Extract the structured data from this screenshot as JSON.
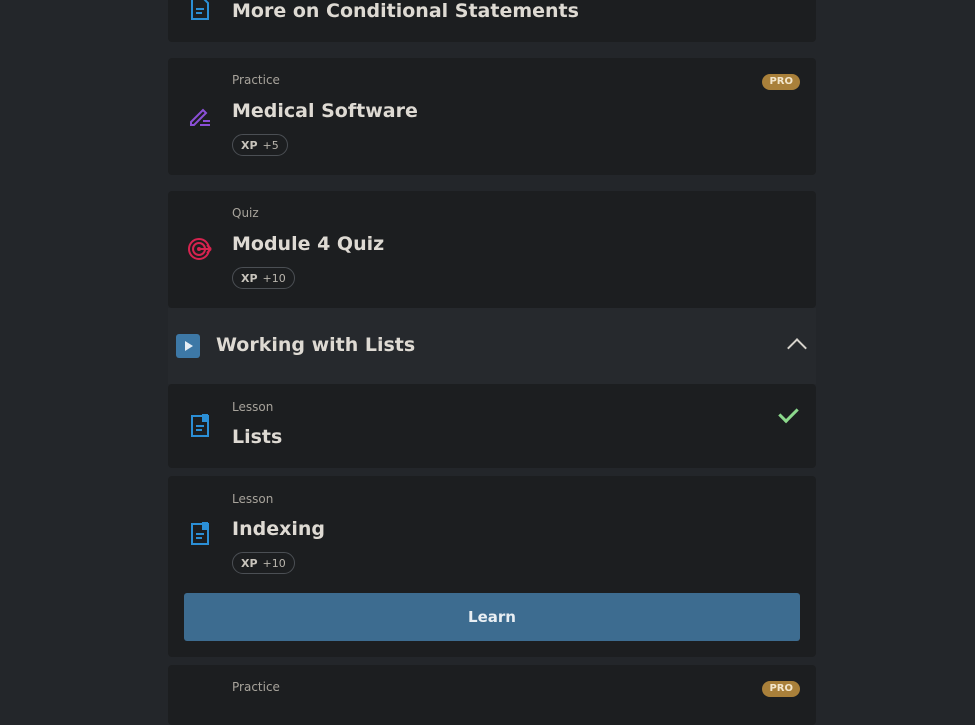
{
  "items": [
    {
      "title": "More on Conditional Statements"
    },
    {
      "type": "Practice",
      "title": "Medical Software",
      "xp_label": "XP",
      "xp_value": "+5",
      "badge": "PRO"
    },
    {
      "type": "Quiz",
      "title": "Module 4 Quiz",
      "xp_label": "XP",
      "xp_value": "+10"
    },
    {
      "type": "Lesson",
      "title": "Lists"
    },
    {
      "type": "Lesson",
      "title": "Indexing",
      "xp_label": "XP",
      "xp_value": "+10",
      "button": "Learn"
    },
    {
      "type": "Practice",
      "badge": "PRO"
    }
  ],
  "section": {
    "title": "Working with Lists"
  },
  "colors": {
    "lesson": "#2b8fd6",
    "practice": "#8b4fd6",
    "quiz": "#d6234f",
    "accent": "#3d6c90",
    "pro": "#a9803a"
  }
}
